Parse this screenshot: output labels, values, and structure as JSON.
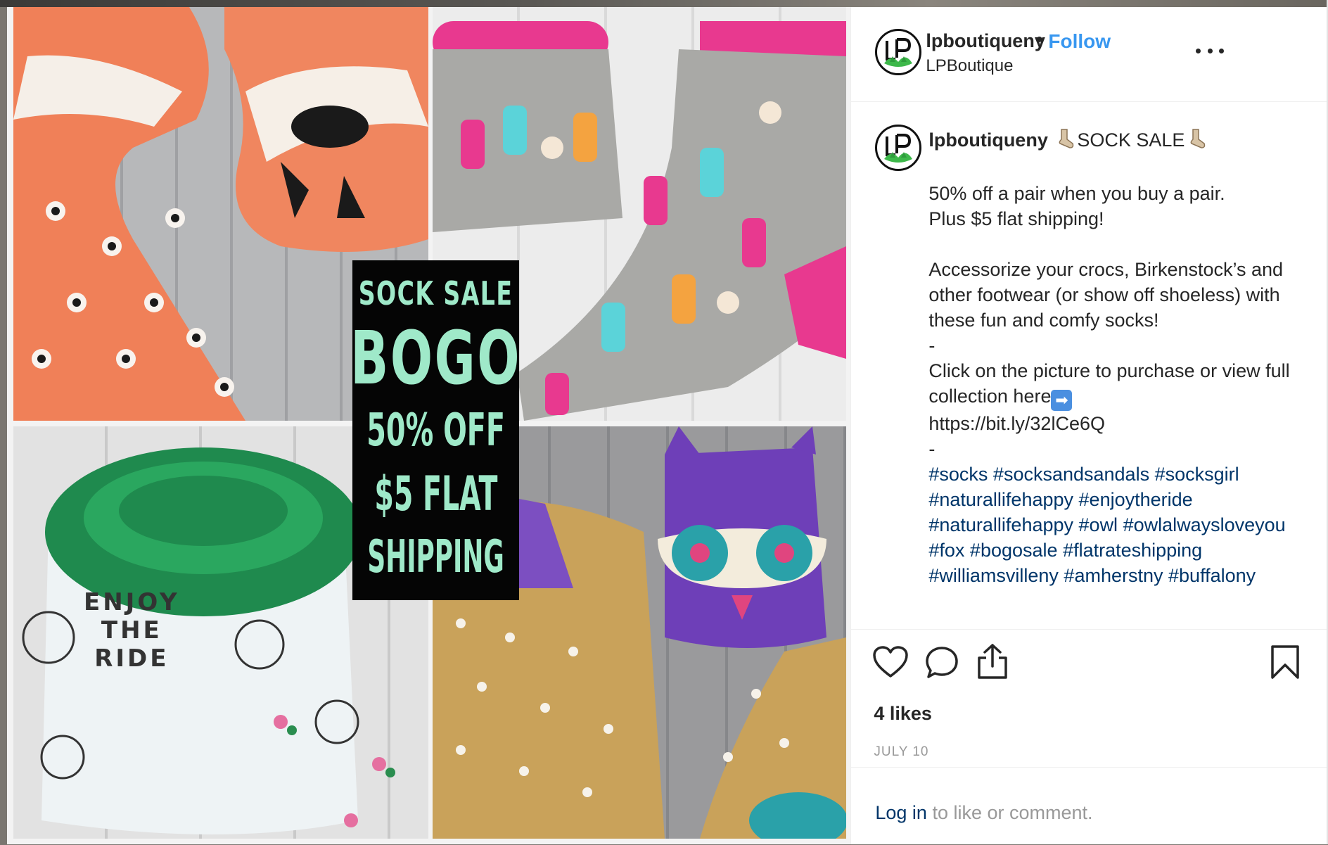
{
  "media": {
    "sale_sign": {
      "line1": "SOCK SALE",
      "line2": "BOGO",
      "line3": "50% OFF",
      "line4": "$5 FLAT",
      "line5": "SHIPPING"
    },
    "bike_sock_text": [
      "ENJOY",
      "THE",
      "RIDE"
    ]
  },
  "header": {
    "username": "lpboutiqueny",
    "separator": "•",
    "follow_label": "Follow",
    "subname": "LPBoutique",
    "more_icon": "more-horizontal-icon"
  },
  "caption": {
    "username": "lpboutiqueny",
    "title": "SOCK SALE",
    "line1": "50% off a pair when you buy a pair.",
    "line2": "Plus $5 flat shipping!",
    "para2": "Accessorize your crocs, Birkenstock’s and other footwear (or show off shoeless) with these fun and comfy socks!",
    "dash1": "-",
    "cta": "Click on the picture to purchase or view full collection here",
    "link": "https://bit.ly/32lCe6Q",
    "dash2": "-",
    "hashtags": [
      "#socks",
      "#socksandsandals",
      "#socksgirl",
      "#naturallifehappy",
      "#enjoytheride",
      "#naturallifehappy",
      "#owl",
      "#owlalwaysloveyou",
      "#fox",
      "#bogosale",
      "#flatrateshipping",
      "#williamsvilleny",
      "#amherstny",
      "#buffalony"
    ]
  },
  "actions": {
    "icons": [
      "heart-icon",
      "comment-icon",
      "share-icon",
      "bookmark-icon"
    ],
    "likes": "4 likes",
    "date": "JULY 10"
  },
  "footer": {
    "login_link": "Log in",
    "login_text": " to like or comment."
  },
  "colors": {
    "link_blue": "#3897f0",
    "hashtag_blue": "#003569",
    "sign_green": "#9fe9c9",
    "text_dark": "#262626",
    "text_muted": "#999999"
  }
}
